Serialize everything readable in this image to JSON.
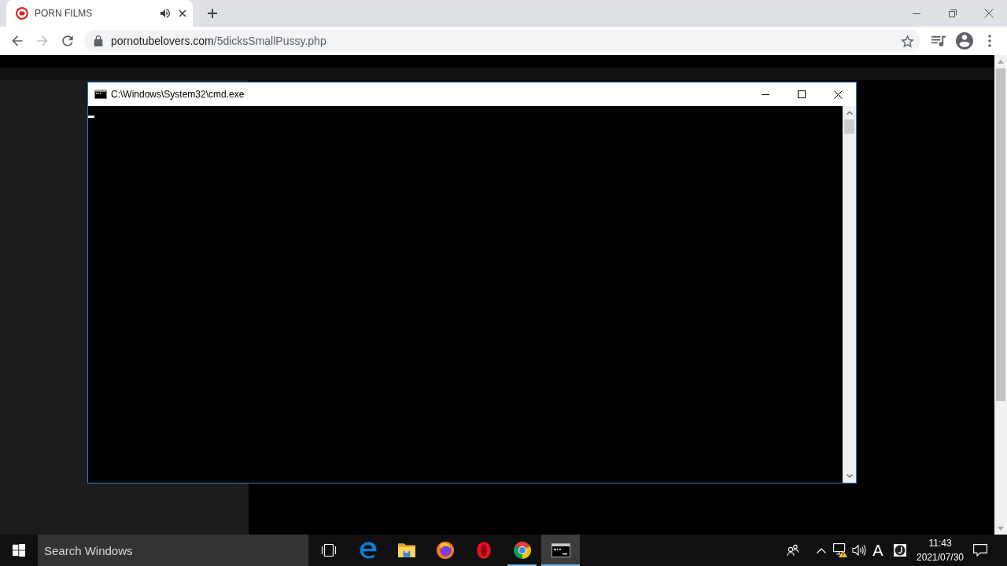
{
  "browser": {
    "tabs": [
      {
        "title": "PORN FILMS",
        "selected": true,
        "audible": true
      }
    ],
    "address_bar": {
      "host": "pornotubelovers.com",
      "path": "/5dicksSmallPussy.php"
    }
  },
  "console_window": {
    "title": "C:\\Windows\\System32\\cmd.exe"
  },
  "taskbar": {
    "search": {
      "placeholder": "Search Windows"
    },
    "apps": [
      {
        "kind": "edge",
        "running": false,
        "selected": false
      },
      {
        "kind": "explorer",
        "running": false,
        "selected": false
      },
      {
        "kind": "firefox",
        "running": false,
        "selected": false
      },
      {
        "kind": "opera",
        "running": false,
        "selected": false
      },
      {
        "kind": "chrome",
        "running": true,
        "selected": false
      },
      {
        "kind": "console",
        "running": true,
        "selected": true
      }
    ],
    "tray": {
      "input_mode": "A",
      "time": "11:43",
      "date": "2021/07/30"
    }
  }
}
